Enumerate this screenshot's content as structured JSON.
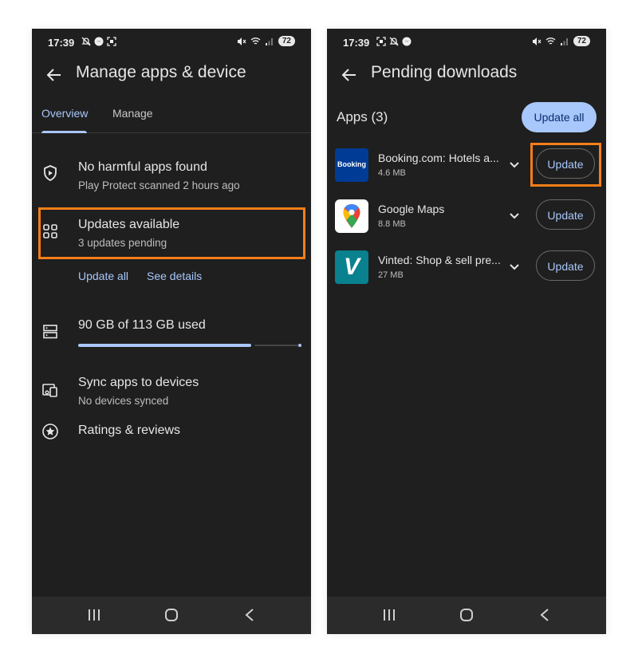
{
  "colors": {
    "background": "#1f1f1f",
    "accent": "#a8c7fa",
    "highlight": "#f57e19",
    "navbar": "#2b2b2b"
  },
  "left_screen": {
    "status_bar": {
      "time": "17:39",
      "battery": "72"
    },
    "title": "Manage apps & device",
    "tabs": [
      {
        "label": "Overview",
        "active": true
      },
      {
        "label": "Manage",
        "active": false
      }
    ],
    "protect": {
      "title": "No harmful apps found",
      "subtitle": "Play Protect scanned 2 hours ago",
      "icon": "shield-play-icon"
    },
    "updates": {
      "title": "Updates available",
      "subtitle": "3 updates pending",
      "icon": "apps-grid-icon",
      "update_all": "Update all",
      "see_details": "See details"
    },
    "storage": {
      "title": "90 GB of 113 GB used",
      "used_gb": 90,
      "total_gb": 113,
      "icon": "storage-icon"
    },
    "sync": {
      "title": "Sync apps to devices",
      "subtitle": "No devices synced",
      "icon": "devices-icon"
    },
    "ratings": {
      "title": "Ratings & reviews",
      "icon": "star-circle-icon"
    }
  },
  "right_screen": {
    "status_bar": {
      "time": "17:39",
      "battery": "72"
    },
    "title": "Pending downloads",
    "apps_header": "Apps (3)",
    "update_all": "Update all",
    "apps": [
      {
        "name": "Booking.com: Hotels a...",
        "size": "4.6 MB",
        "button": "Update",
        "icon_text": "Booking"
      },
      {
        "name": "Google Maps",
        "size": "8.8 MB",
        "button": "Update"
      },
      {
        "name": "Vinted: Shop & sell pre...",
        "size": "27 MB",
        "button": "Update",
        "icon_text": "V"
      }
    ]
  },
  "nav_icons": [
    "recents-icon",
    "home-icon",
    "back-nav-icon"
  ]
}
